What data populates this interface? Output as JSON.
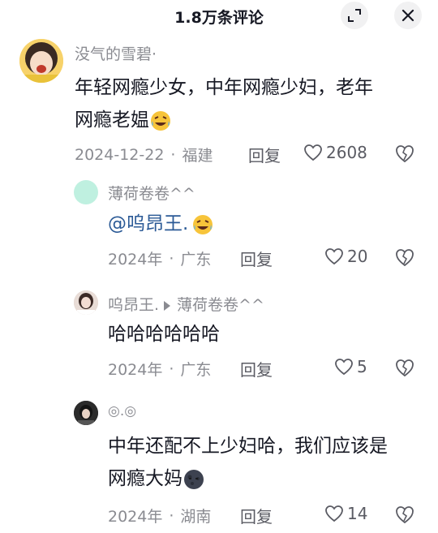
{
  "header": {
    "title": "1.8万条评论",
    "expand_icon": "expand-icon",
    "close_icon": "close-icon"
  },
  "comments": [
    {
      "author": "没气的雪碧·",
      "text_line1": "年轻网瘾少女，中年网瘾少妇，老年",
      "text_line2": "网瘾老媪",
      "emoji": "laughing-crying-emoji",
      "date": "2024-12-22",
      "separator": "·",
      "location": "福建",
      "reply_label": "回复",
      "likes": "2608"
    },
    {
      "author": "薄荷卷卷^^",
      "mention": "@呜昂王.",
      "emoji": "laughing-crying-emoji",
      "date": "2024年",
      "separator": "·",
      "location": "广东",
      "reply_label": "回复",
      "likes": "20"
    },
    {
      "author": "呜昂王.",
      "reply_to": "薄荷卷卷^^",
      "text": "哈哈哈哈哈哈",
      "date": "2024年",
      "separator": "·",
      "location": "广东",
      "reply_label": "回复",
      "likes": "5"
    },
    {
      "author": "◎.◎",
      "text_line1": "中年还配不上少妇哈，我们应该是",
      "text_line2": "网瘾大妈",
      "emoji": "new-moon-face-emoji",
      "date": "2024年",
      "separator": "·",
      "location": "湖南",
      "reply_label": "回复",
      "likes": "14"
    }
  ],
  "colors": {
    "text_primary": "#161823",
    "text_secondary": "#8a8b91",
    "mention": "#2b5a96",
    "avatar_mint": "#bff0e0"
  }
}
